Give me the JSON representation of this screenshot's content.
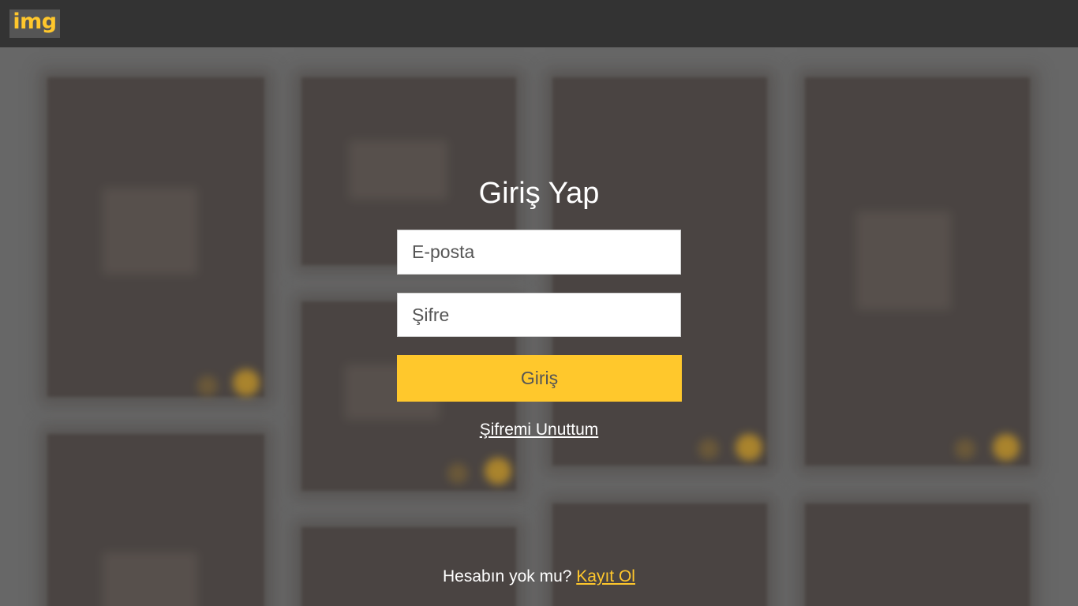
{
  "header": {
    "logo_text": "img",
    "logo_color": "#ffc72c",
    "bar_color": "#333333"
  },
  "login": {
    "title": "Giriş Yap",
    "email_placeholder": "E-posta",
    "password_placeholder": "Şifre",
    "submit_label": "Giriş",
    "forgot_label": "Şifremi Unuttum",
    "no_account_text": "Hesabın yok mu?",
    "signup_label": "Kayıt Ol",
    "accent_color": "#ffc82c"
  }
}
